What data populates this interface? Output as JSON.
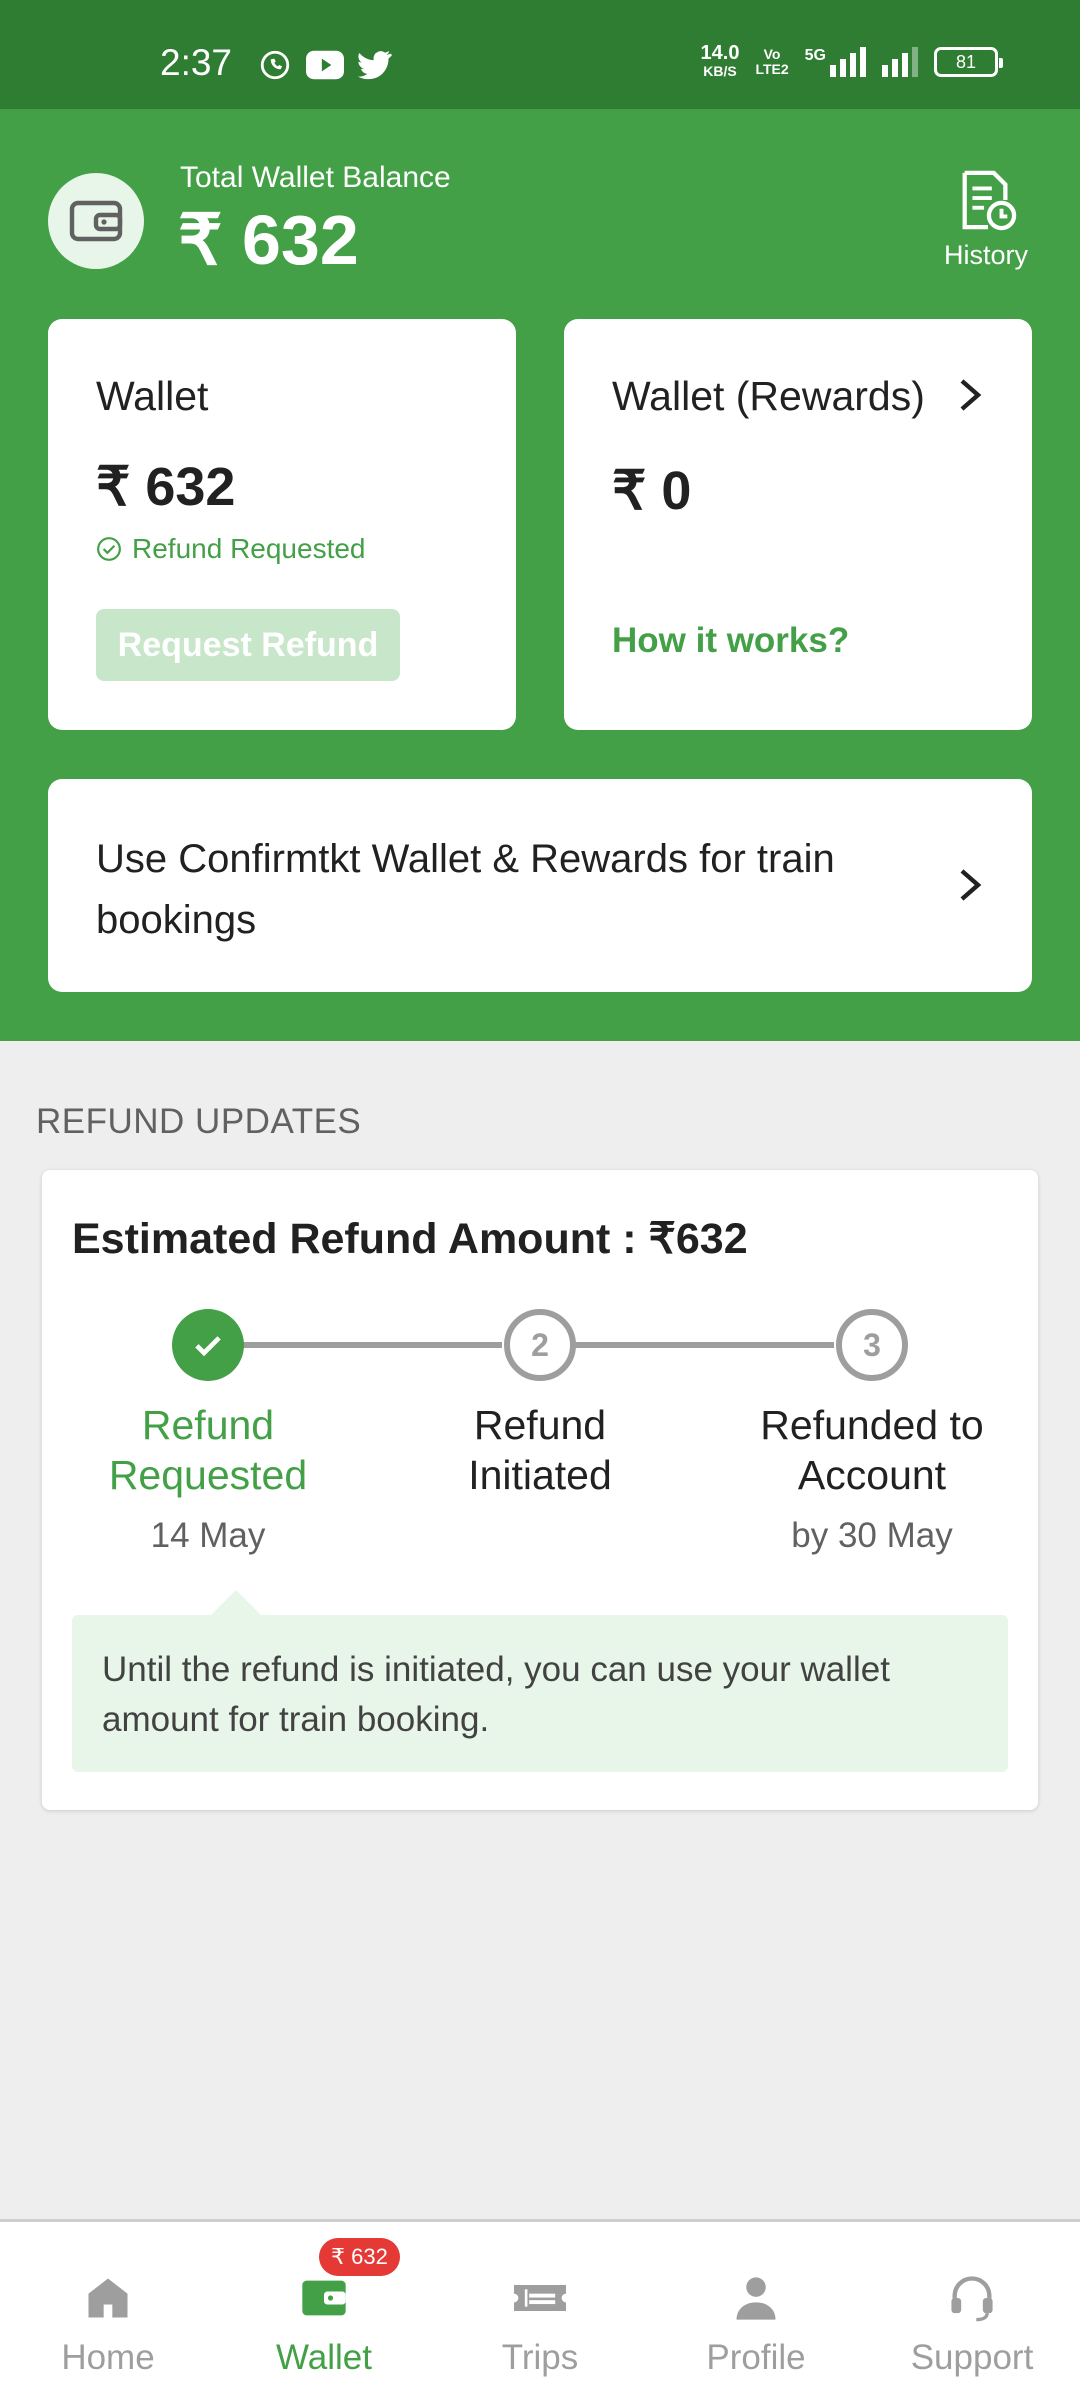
{
  "status_bar": {
    "time": "2:37",
    "net_speed": "14.0",
    "net_unit": "KB/S",
    "volte": "Vo\nLTE2",
    "net_type": "5G",
    "battery": "81"
  },
  "header": {
    "total_label": "Total Wallet Balance",
    "total_amount": "₹ 632",
    "history_label": "History"
  },
  "wallet_card": {
    "title": "Wallet",
    "amount": "₹ 632",
    "status": "Refund Requested",
    "button_label": "Request Refund"
  },
  "rewards_card": {
    "title": "Wallet (Rewards)",
    "amount": "₹ 0",
    "link": "How it works?"
  },
  "use_card": {
    "text": "Use Confirmtkt Wallet & Rewards for train bookings"
  },
  "refund_updates": {
    "section_title": "REFUND UPDATES",
    "estimate": "Estimated Refund Amount : ₹632",
    "steps": [
      {
        "number": "1",
        "label": "Refund Requested",
        "date": "14 May",
        "state": "done"
      },
      {
        "number": "2",
        "label": "Refund Initiated",
        "date": "",
        "state": "pending"
      },
      {
        "number": "3",
        "label": "Refunded to Account",
        "date": "by 30 May",
        "state": "pending"
      }
    ],
    "info": "Until the refund is initiated, you can use your wallet amount for train booking."
  },
  "bottom_nav": {
    "items": [
      {
        "label": "Home",
        "icon": "home-icon"
      },
      {
        "label": "Wallet",
        "icon": "wallet-icon",
        "badge": "₹ 632",
        "active": true
      },
      {
        "label": "Trips",
        "icon": "ticket-icon"
      },
      {
        "label": "Profile",
        "icon": "person-icon"
      },
      {
        "label": "Support",
        "icon": "headset-icon"
      }
    ]
  },
  "colors": {
    "primary": "#43a047",
    "status_bar": "#2e7d32",
    "badge": "#e53935",
    "inactive": "#9e9e9e"
  }
}
